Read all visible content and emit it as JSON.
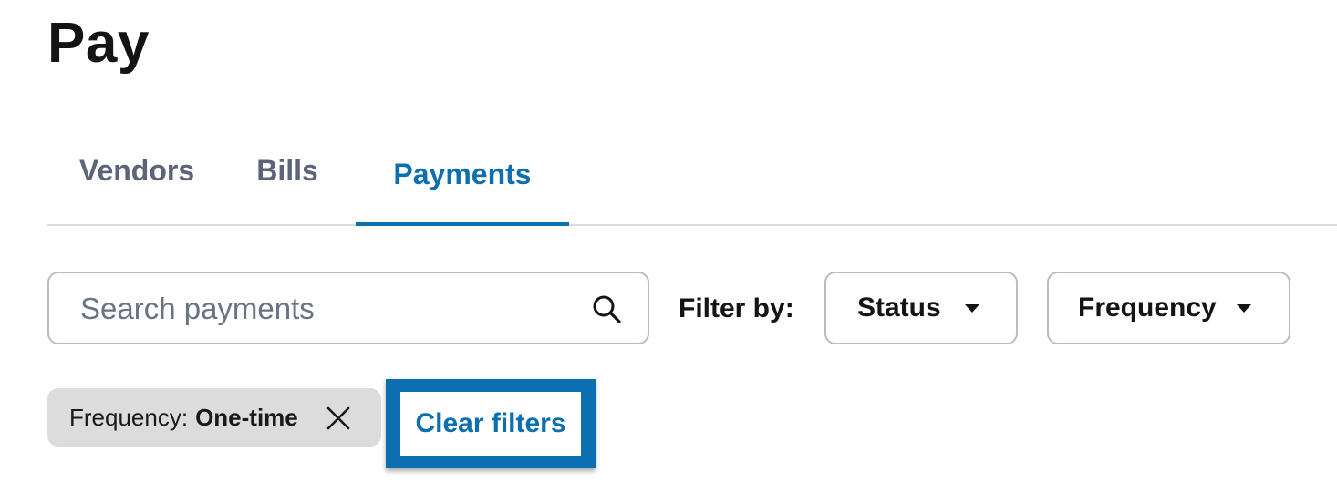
{
  "page": {
    "title": "Pay"
  },
  "tabs": [
    {
      "label": "Vendors",
      "active": false
    },
    {
      "label": "Bills",
      "active": false
    },
    {
      "label": "Payments",
      "active": true
    }
  ],
  "search": {
    "placeholder": "Search payments",
    "value": "",
    "icon": "search-icon"
  },
  "filters": {
    "label": "Filter by:",
    "dropdowns": [
      {
        "label": "Status",
        "icon": "caret-down-icon"
      },
      {
        "label": "Frequency",
        "icon": "caret-down-icon"
      }
    ]
  },
  "active_filters": [
    {
      "key": "Frequency:",
      "value": "One-time",
      "icon": "close-icon"
    }
  ],
  "clear_filters": {
    "label": "Clear filters"
  },
  "colors": {
    "accent": "#0b6fb0",
    "tab_inactive": "#5b6478",
    "chip_bg": "#dcdcdd",
    "border": "#b9bcc2"
  }
}
